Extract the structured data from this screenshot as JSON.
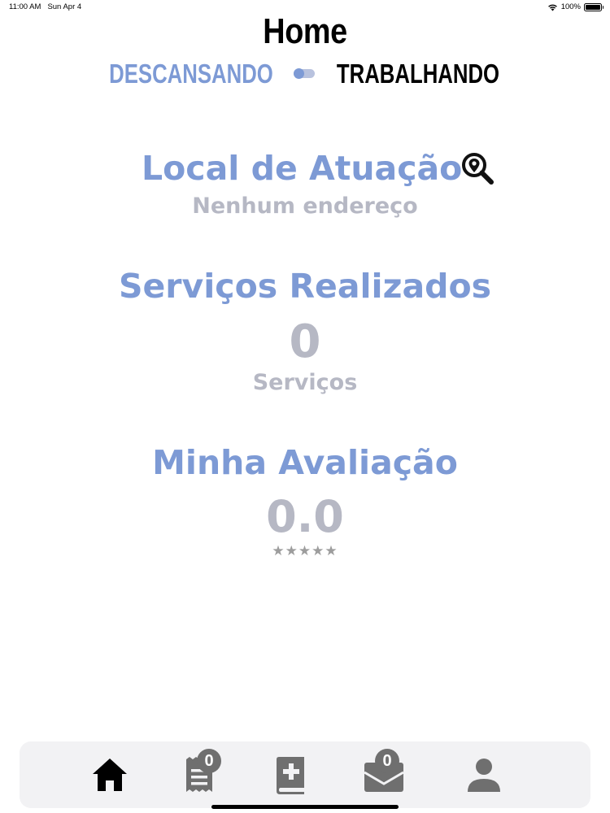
{
  "status_bar": {
    "time": "11:00 AM",
    "date": "Sun Apr 4",
    "battery": "100%"
  },
  "header": {
    "title": "Home"
  },
  "mode_toggle": {
    "off_label": "DESCANSANDO",
    "on_label": "TRABALHANDO",
    "is_on": false
  },
  "location": {
    "title": "Local de Atuação",
    "value": "Nenhum endereço",
    "icon": "search-location-icon"
  },
  "services": {
    "title": "Serviços Realizados",
    "count": "0",
    "unit": "Serviços"
  },
  "rating": {
    "title": "Minha Avaliação",
    "value": "0.0",
    "stars": "★★★★★",
    "star_count": 0
  },
  "tab_bar": {
    "tabs": [
      {
        "name": "home",
        "icon": "home-icon",
        "active": true
      },
      {
        "name": "receipts",
        "icon": "receipt-icon",
        "badge": "0"
      },
      {
        "name": "services-book",
        "icon": "medical-book-icon"
      },
      {
        "name": "inbox",
        "icon": "mail-icon",
        "badge": "0"
      },
      {
        "name": "profile",
        "icon": "user-icon"
      }
    ]
  },
  "colors": {
    "accent": "#7d9ad5",
    "muted": "#b6b8c4",
    "active_icon": "#000000",
    "inactive_icon": "#6f6f6f"
  }
}
